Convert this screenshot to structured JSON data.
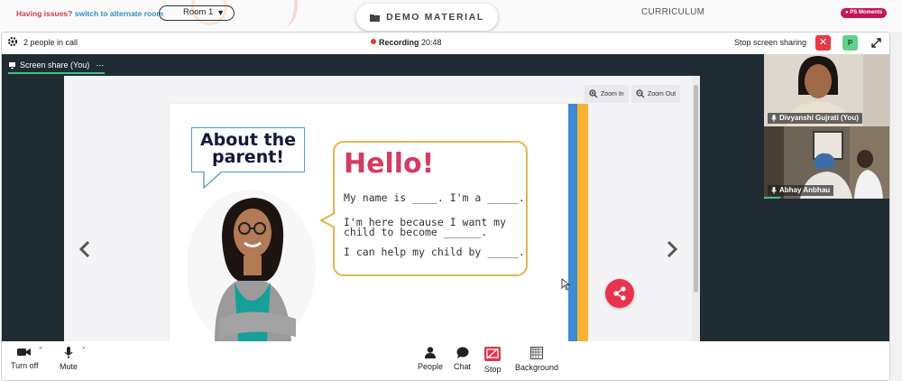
{
  "topbar": {
    "issue_prefix": "Having issues?",
    "issue_link": "switch to alternate room",
    "room_select": "Room 1",
    "demo_button": "DEMO MATERIAL",
    "curriculum": "CURRICULUM",
    "badge": "PS Moments"
  },
  "call": {
    "people_count": "2 people in call",
    "recording_label": "Recording",
    "recording_time": "20:48",
    "stop_sharing": "Stop screen sharing",
    "avatar_initial": "P"
  },
  "share": {
    "tab_label": "Screen share (You)",
    "more": "⋯",
    "zoom_in": "Zoom In",
    "zoom_out": "Zoom Out"
  },
  "slide": {
    "heading_line1": "About the",
    "heading_line2": "parent!",
    "hello": "Hello!",
    "line1": "My name is ____. I'm a _____.",
    "line2a": "I'm here because I want my",
    "line2b": "child to become ______.",
    "line3": "I can help my child by _____."
  },
  "participants": [
    {
      "name": "Divyanshi Gujrati (You)"
    },
    {
      "name": "Abhay Anbhau"
    }
  ],
  "toolbar": {
    "camera": "Turn off",
    "mic": "Mute",
    "people": "People",
    "chat": "Chat",
    "stop": "Stop",
    "background": "Background"
  },
  "colors": {
    "accent_green": "#3fc089",
    "danger_red": "#e53945",
    "hello_pink": "#d63b63",
    "bubble_gold": "#e6b54a",
    "stage_dark": "#1f2c33"
  }
}
